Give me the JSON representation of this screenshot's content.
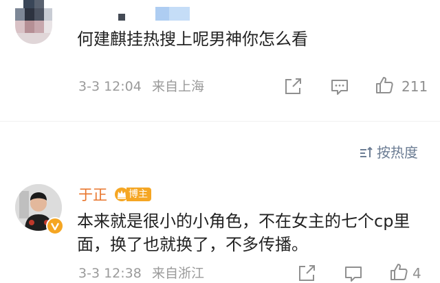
{
  "comment_1": {
    "text": "何建麒挂热搜上呢男神你怎么看",
    "date": "3-3 12:04",
    "location": "来自上海",
    "likes": "211",
    "icons": [
      "share-icon",
      "comment-icon",
      "like-icon"
    ]
  },
  "sort": {
    "label": "按热度",
    "icon": "sort-icon"
  },
  "comment_2": {
    "author": "于正",
    "badge": "博主",
    "text": "本来就是很小的小角色，不在女主的七个cp里面，换了也就换了，不多传播。",
    "date": "3-3 12:38",
    "location": "来自浙江"
  },
  "colors": {
    "author": "#e8742a",
    "badge": "#f5a623",
    "meta": "#9a9a9a",
    "sort": "#6b7c93"
  }
}
